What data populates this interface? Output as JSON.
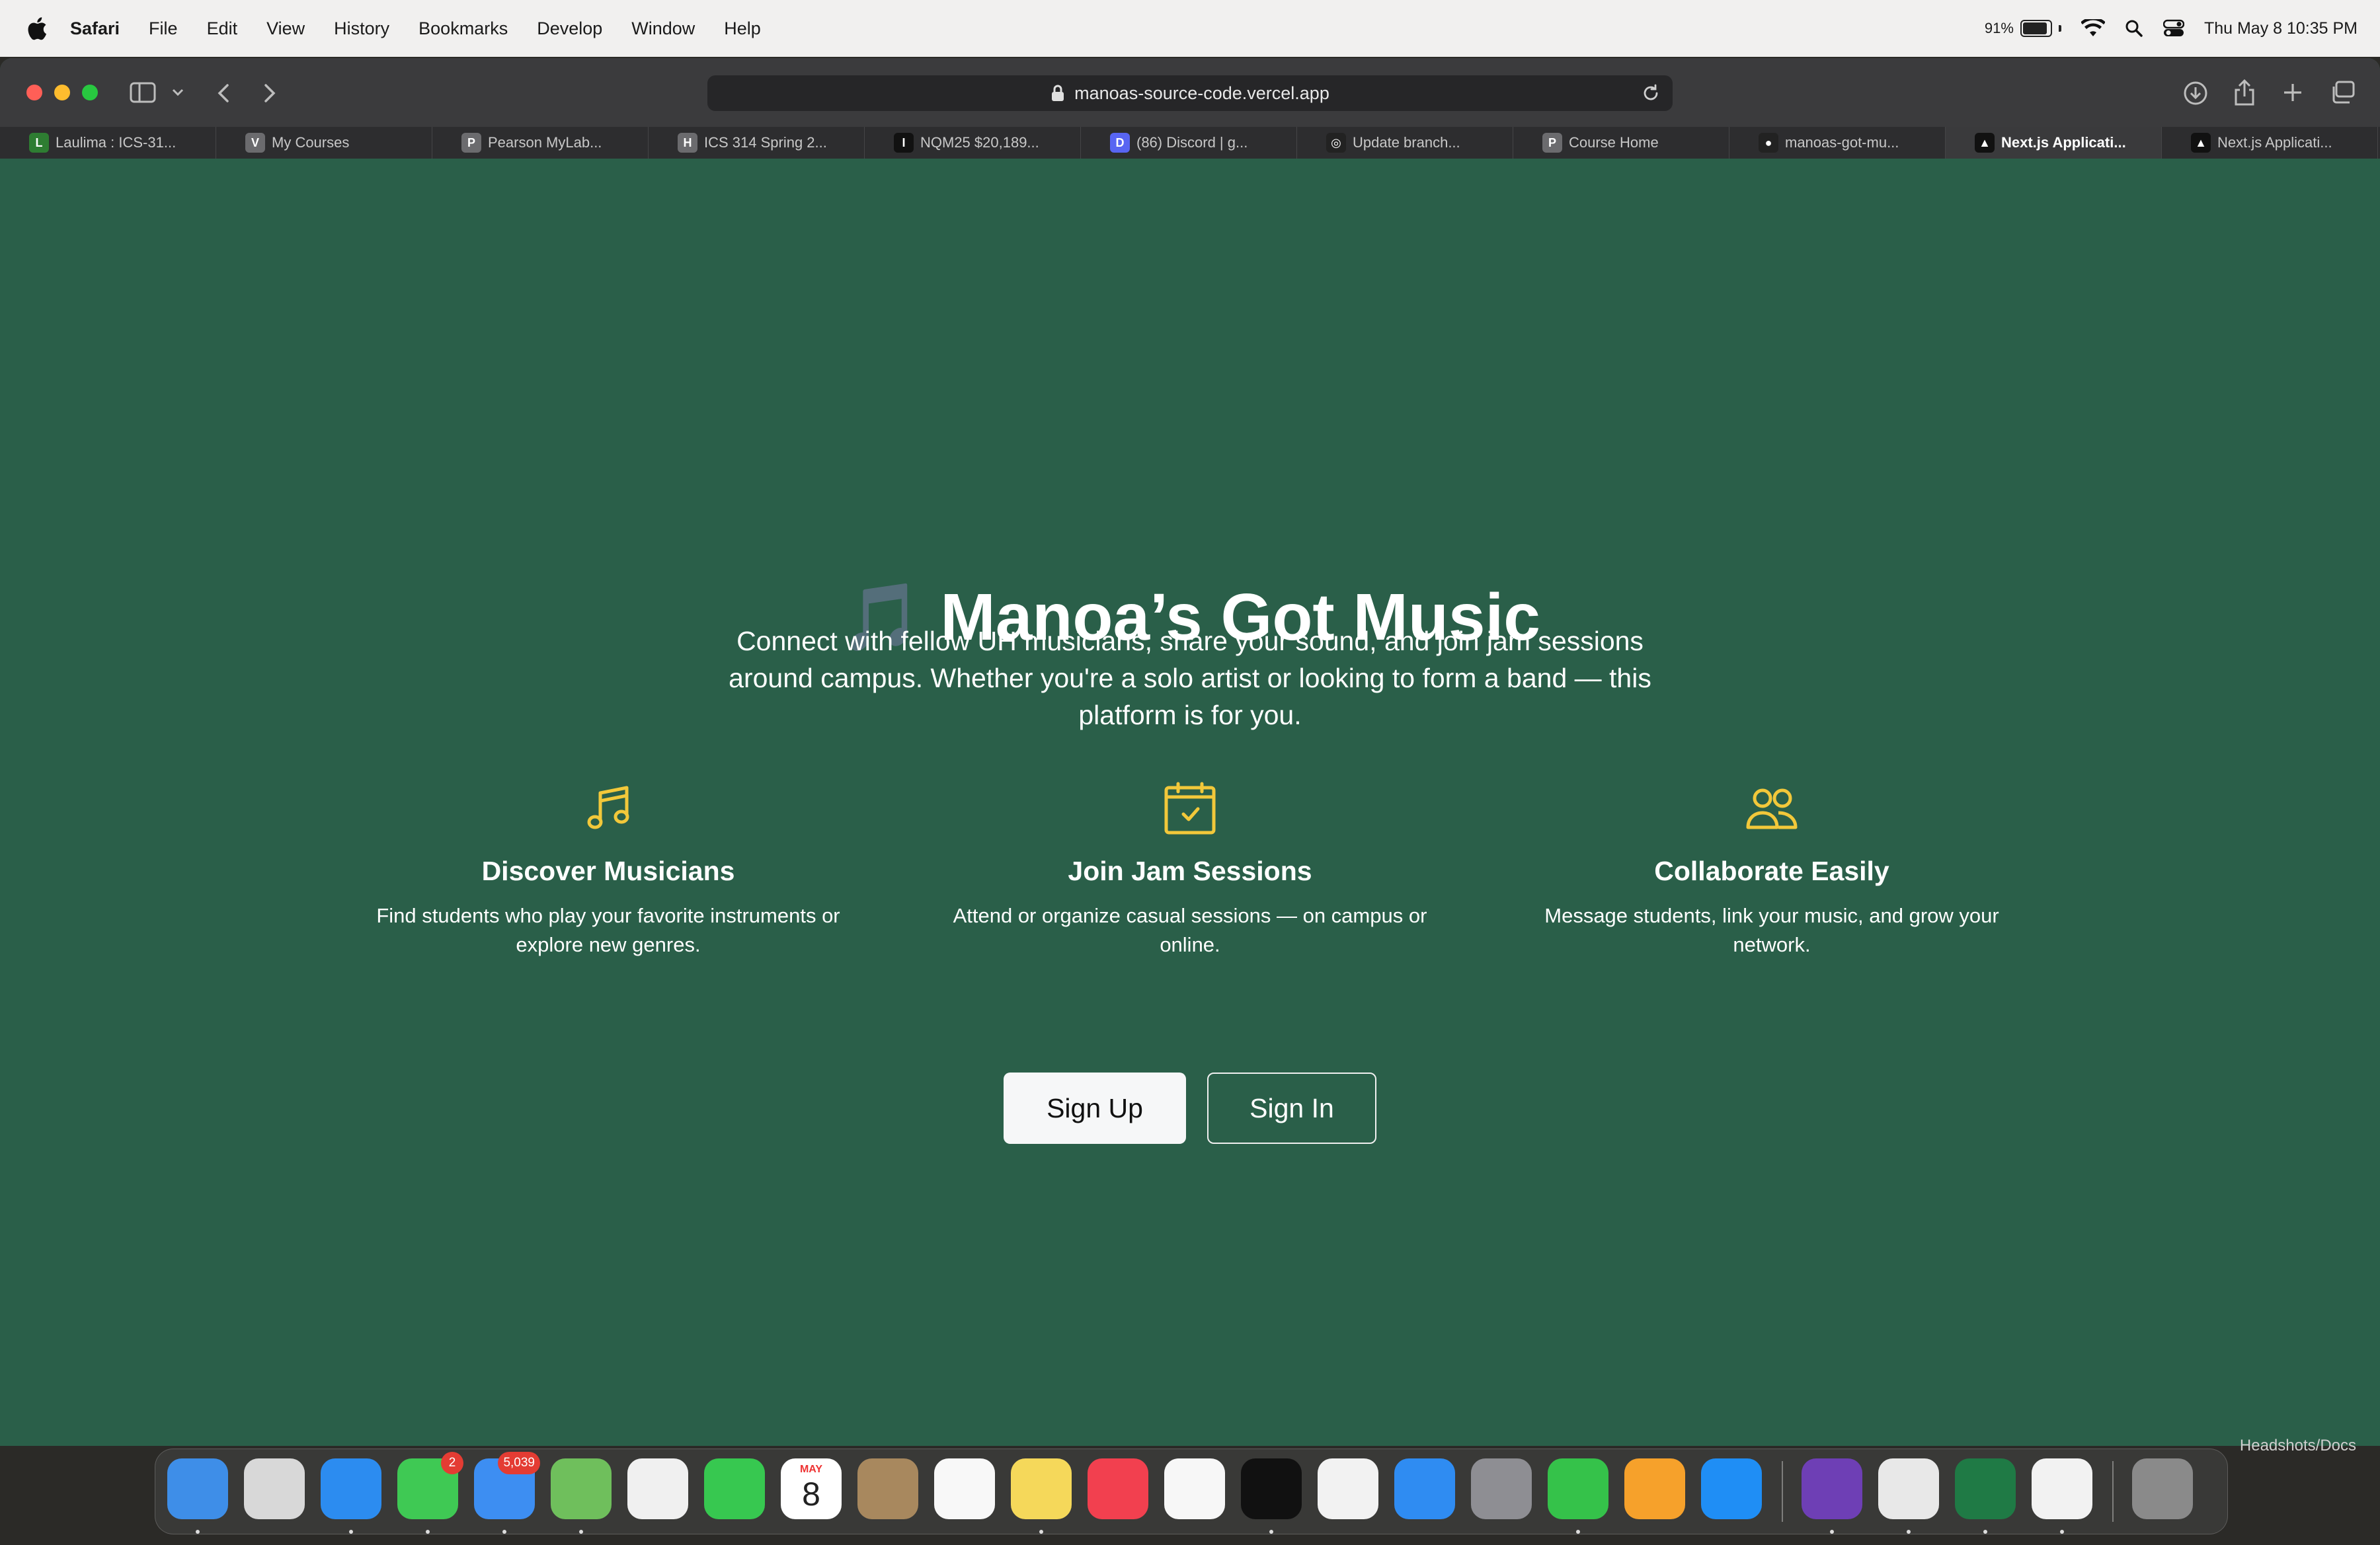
{
  "menubar": {
    "app": "Safari",
    "items": [
      "File",
      "Edit",
      "View",
      "History",
      "Bookmarks",
      "Develop",
      "Window",
      "Help"
    ],
    "battery": "91%",
    "battery_level": 0.91,
    "datetime": "Thu May 8  10:35 PM"
  },
  "browser": {
    "url": "manoas-source-code.vercel.app",
    "tabs": [
      {
        "label": "Laulima : ICS-31...",
        "fav": "L",
        "color": "#2e7d32"
      },
      {
        "label": "My Courses",
        "fav": "V",
        "color": "#6b6b6e"
      },
      {
        "label": "Pearson MyLab...",
        "fav": "P",
        "color": "#6b6b6e"
      },
      {
        "label": "ICS 314 Spring 2...",
        "fav": "H",
        "color": "#6b6b6e"
      },
      {
        "label": "NQM25 $20,189...",
        "fav": "I",
        "color": "#111111"
      },
      {
        "label": "(86) Discord | g...",
        "fav": "D",
        "color": "#5865f2"
      },
      {
        "label": "Update branch...",
        "fav": "◎",
        "color": "#222222"
      },
      {
        "label": "Course Home",
        "fav": "P",
        "color": "#6b6b6e"
      },
      {
        "label": "manoas-got-mu...",
        "fav": "●",
        "color": "#222222"
      },
      {
        "label": "Next.js Applicati...",
        "fav": "▲",
        "color": "#111111",
        "active": true
      },
      {
        "label": "Next.js Applicati...",
        "fav": "▲",
        "color": "#111111"
      }
    ]
  },
  "hero": {
    "emoji": "🎵",
    "title": "Manoa’s Got Music",
    "subtitle": "Connect with fellow UH musicians, share your sound, and join jam sessions around campus. Whether you're a solo artist or looking to form a band — this platform is for you."
  },
  "features": [
    {
      "title": "Discover Musicians",
      "text": "Find students who play your favorite instruments or explore new genres.",
      "icon": "music-note-icon"
    },
    {
      "title": "Join Jam Sessions",
      "text": "Attend or organize casual sessions — on campus or online.",
      "icon": "calendar-check-icon"
    },
    {
      "title": "Collaborate Easily",
      "text": "Message students, link your music, and grow your network.",
      "icon": "people-icon"
    }
  ],
  "buttons": {
    "signup": "Sign Up",
    "signin": "Sign In"
  },
  "dock": {
    "apps": [
      {
        "name": "finder",
        "color": "#3e8ee8"
      },
      {
        "name": "launchpad",
        "color": "#d8d8d8"
      },
      {
        "name": "safari",
        "color": "#2c8cf0"
      },
      {
        "name": "messages",
        "color": "#3fc954",
        "badge": "2"
      },
      {
        "name": "mail",
        "color": "#3d8ef2",
        "badge": "5,039"
      },
      {
        "name": "maps",
        "color": "#6fbf5c"
      },
      {
        "name": "photos",
        "color": "#f0f0f0"
      },
      {
        "name": "facetime",
        "color": "#37c850"
      },
      {
        "name": "calendar",
        "color": "#ffffff",
        "label_top": "MAY",
        "label_day": "8"
      },
      {
        "name": "contacts",
        "color": "#a8885e"
      },
      {
        "name": "reminders",
        "color": "#f8f8f8"
      },
      {
        "name": "notes",
        "color": "#f5d85a"
      },
      {
        "name": "music",
        "color": "#f2404f"
      },
      {
        "name": "freeform",
        "color": "#f7f7f7"
      },
      {
        "name": "tv",
        "color": "#111111"
      },
      {
        "name": "news",
        "color": "#f2f2f2"
      },
      {
        "name": "keynote",
        "color": "#2f8cf2"
      },
      {
        "name": "system-settings",
        "color": "#8e8e93"
      },
      {
        "name": "numbers",
        "color": "#35c24a"
      },
      {
        "name": "pages",
        "color": "#f6a12b"
      },
      {
        "name": "app-store",
        "color": "#1f8ef5"
      },
      {
        "name": "github-desktop",
        "color": "#6e3fb5"
      },
      {
        "name": "chrome",
        "color": "#e8e8e8"
      },
      {
        "name": "excel",
        "color": "#1f7a45"
      },
      {
        "name": "vscode",
        "color": "#f2f2f2"
      },
      {
        "name": "trash",
        "color": "#8a8a8a"
      }
    ],
    "desktop_label": "Headshots/Docs"
  }
}
